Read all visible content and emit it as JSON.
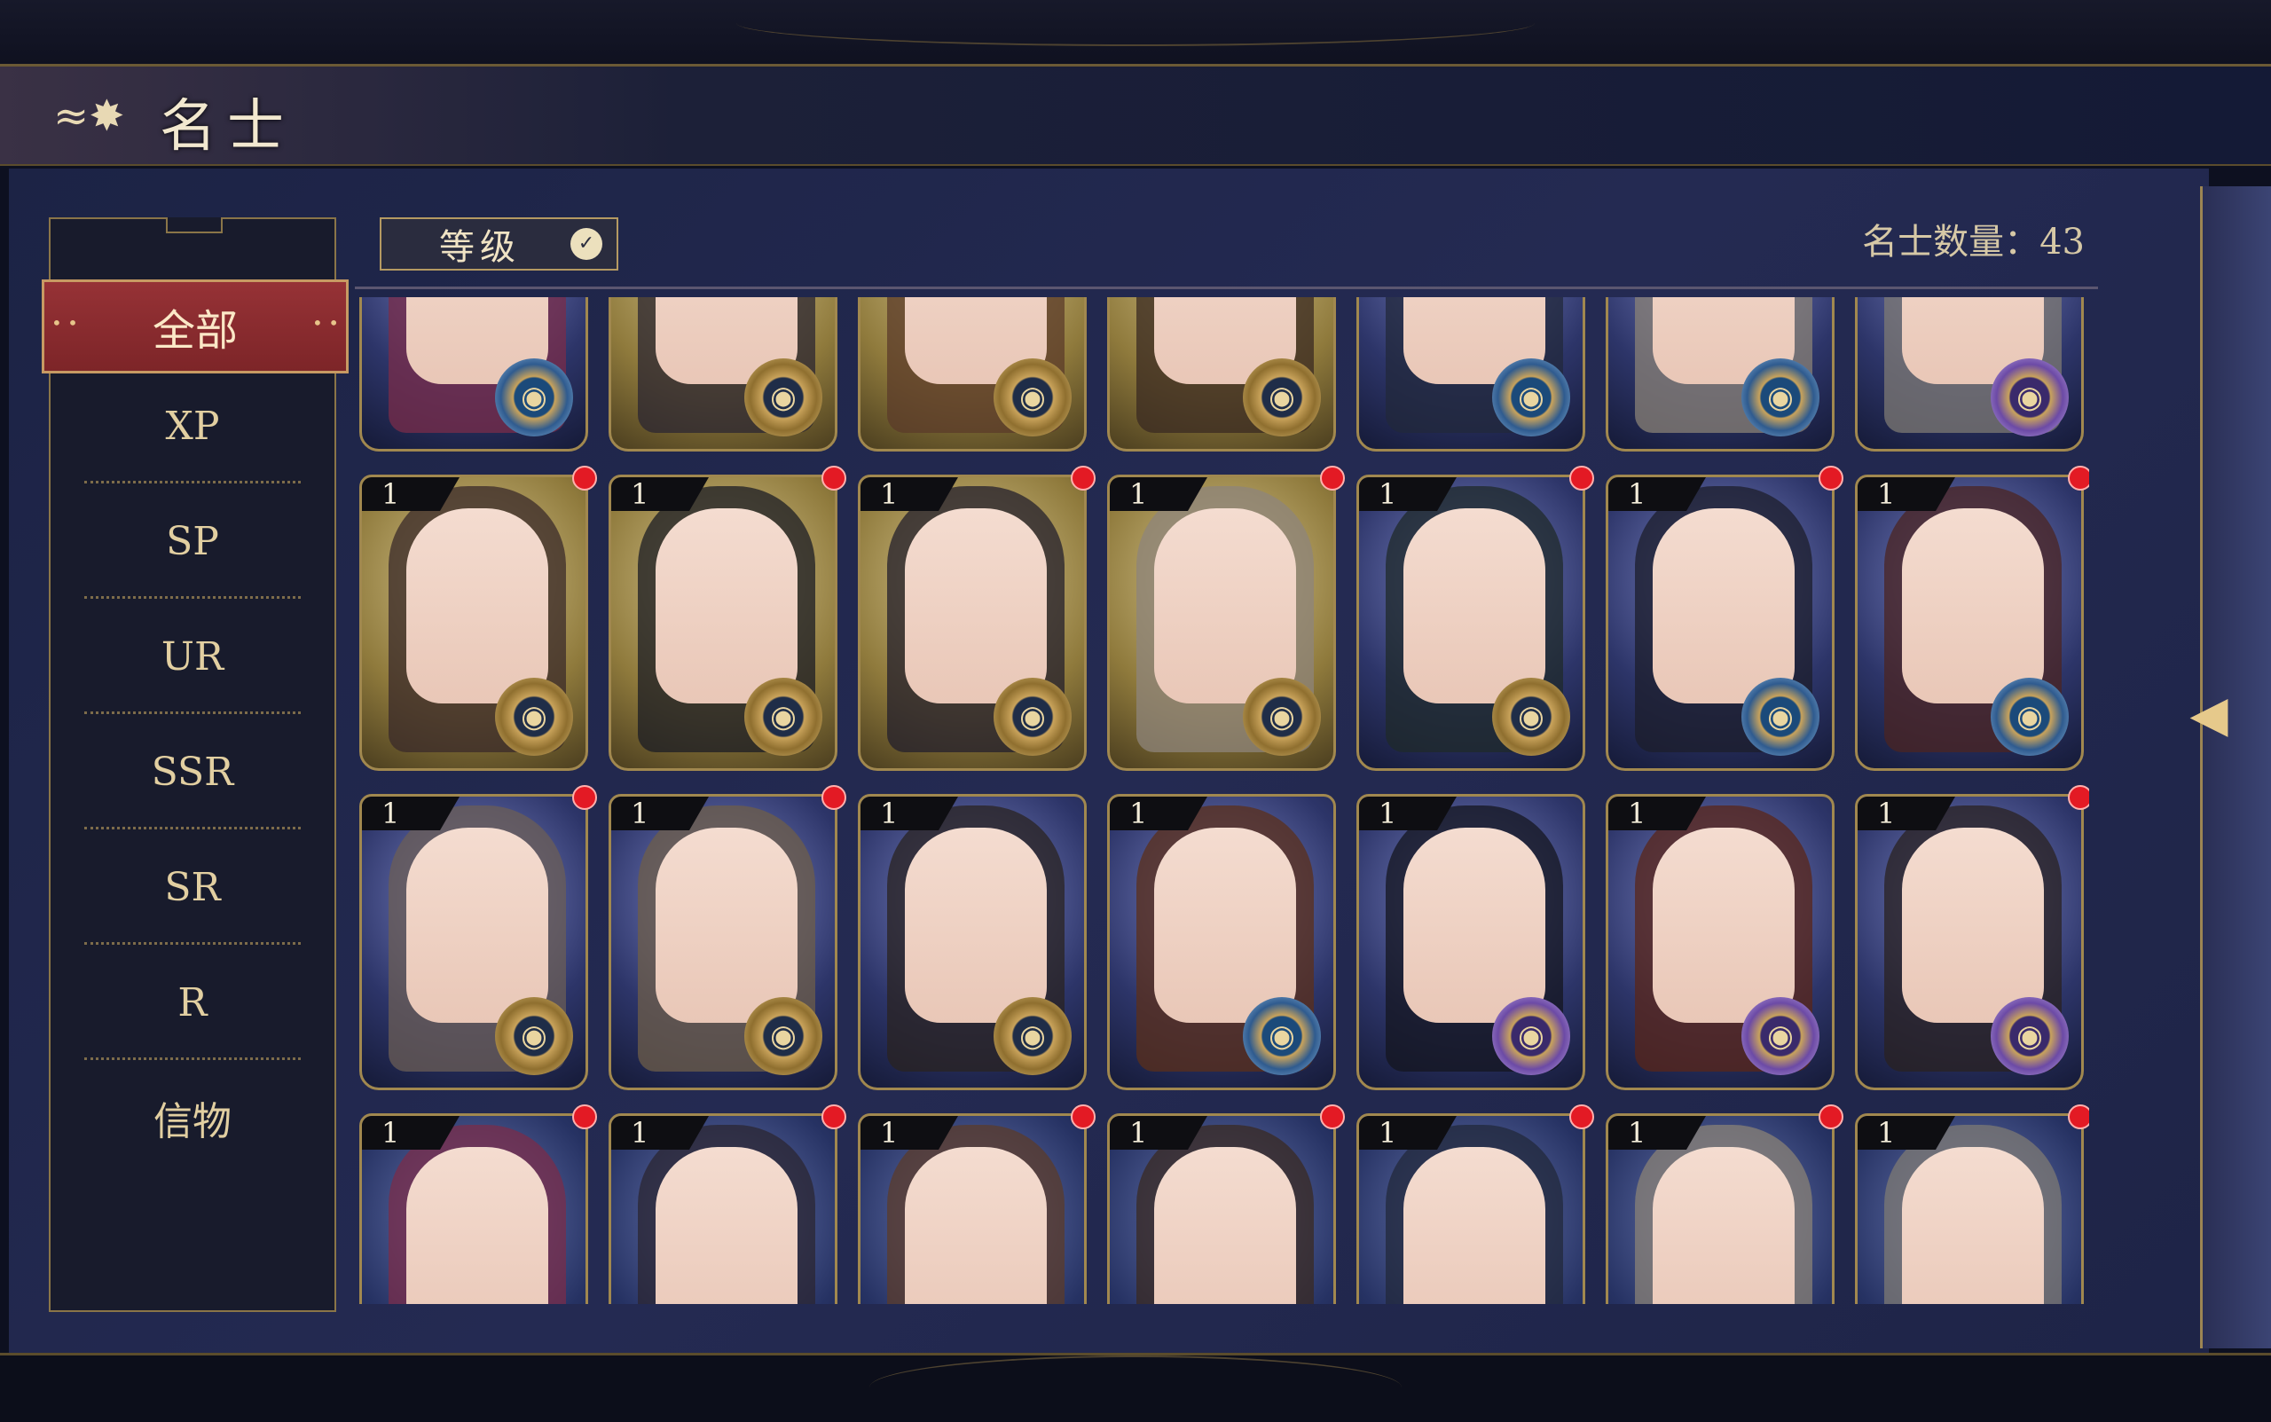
{
  "header": {
    "title": "名士",
    "icon": "cloud-swirl-icon"
  },
  "sidebar": {
    "items": [
      {
        "label": "全部",
        "active": true
      },
      {
        "label": "XP"
      },
      {
        "label": "SP"
      },
      {
        "label": "UR"
      },
      {
        "label": "SSR"
      },
      {
        "label": "SR"
      },
      {
        "label": "R"
      },
      {
        "label": "信物"
      }
    ]
  },
  "toolbar": {
    "sort_label": "等级",
    "sort_icon": "chevron-down-icon",
    "count_text": "名士数量：43"
  },
  "grid": {
    "rows": [
      {
        "cards": [
          {
            "level": "",
            "bg": "blue",
            "medal": "sky",
            "dot": false
          },
          {
            "level": "",
            "bg": "gold",
            "medal": "gold",
            "dot": false
          },
          {
            "level": "",
            "bg": "gold",
            "medal": "gold",
            "dot": false
          },
          {
            "level": "",
            "bg": "gold",
            "medal": "gold",
            "dot": false
          },
          {
            "level": "",
            "bg": "blue",
            "medal": "sky",
            "dot": false
          },
          {
            "level": "",
            "bg": "blue",
            "medal": "sky",
            "dot": false
          },
          {
            "level": "",
            "bg": "blue",
            "medal": "purple",
            "dot": false
          }
        ]
      },
      {
        "cards": [
          {
            "level": "1",
            "bg": "gold",
            "medal": "gold",
            "dot": true
          },
          {
            "level": "1",
            "bg": "gold",
            "medal": "gold",
            "dot": true
          },
          {
            "level": "1",
            "bg": "gold",
            "medal": "gold",
            "dot": true
          },
          {
            "level": "1",
            "bg": "gold",
            "medal": "gold",
            "dot": true
          },
          {
            "level": "1",
            "bg": "blue",
            "medal": "gold",
            "dot": true
          },
          {
            "level": "1",
            "bg": "blue",
            "medal": "sky",
            "dot": true
          },
          {
            "level": "1",
            "bg": "blue",
            "medal": "sky",
            "dot": true
          }
        ]
      },
      {
        "cards": [
          {
            "level": "1",
            "bg": "blue",
            "medal": "gold",
            "dot": true
          },
          {
            "level": "1",
            "bg": "blue",
            "medal": "gold",
            "dot": true
          },
          {
            "level": "1",
            "bg": "blue",
            "medal": "gold",
            "dot": false
          },
          {
            "level": "1",
            "bg": "blue",
            "medal": "sky",
            "dot": false
          },
          {
            "level": "1",
            "bg": "blue",
            "medal": "purple",
            "dot": false
          },
          {
            "level": "1",
            "bg": "blue",
            "medal": "purple",
            "dot": false
          },
          {
            "level": "1",
            "bg": "blue",
            "medal": "purple",
            "dot": true
          }
        ]
      },
      {
        "cards": [
          {
            "level": "1",
            "bg": "dblue",
            "medal": "purple",
            "dot": true
          },
          {
            "level": "1",
            "bg": "dblue",
            "medal": "gold",
            "dot": true
          },
          {
            "level": "1",
            "bg": "dblue",
            "medal": "purple",
            "dot": true
          },
          {
            "level": "1",
            "bg": "dblue",
            "medal": "purple",
            "dot": true
          },
          {
            "level": "1",
            "bg": "dblue",
            "medal": "purple",
            "dot": true
          },
          {
            "level": "1",
            "bg": "dblue",
            "medal": "purple",
            "dot": true
          },
          {
            "level": "1",
            "bg": "dblue",
            "medal": "purple",
            "dot": true
          }
        ]
      }
    ]
  },
  "colors": {
    "active_tab": "#8b2b2f",
    "gold": "#b59a62",
    "panel": "#1f2548",
    "badge": "#e31a24"
  },
  "icons": {
    "collapse": "collapse-arrow-icon",
    "medal": "faction-medal-icon"
  }
}
